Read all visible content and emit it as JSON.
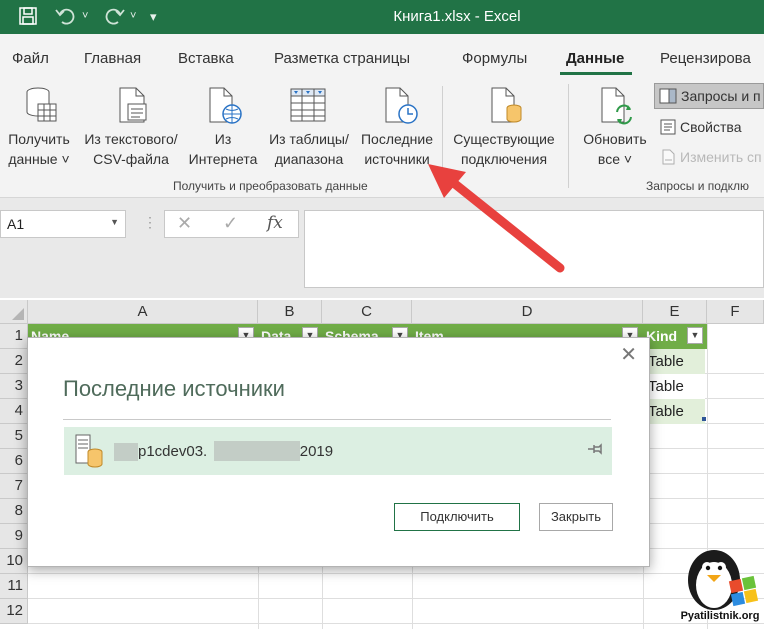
{
  "titlebar": {
    "title": "Книга1.xlsx  -  Excel",
    "bg_color": "#217346"
  },
  "tabs": [
    "Файл",
    "Главная",
    "Вставка",
    "Разметка страницы",
    "Формулы",
    "Данные",
    "Рецензирова"
  ],
  "active_tab": "Данные",
  "ribbon": {
    "get_data": {
      "line1": "Получить",
      "line2": "данные ˅"
    },
    "from_text": {
      "line1": "Из текстового/",
      "line2": "CSV-файла"
    },
    "from_web": {
      "line1": "Из",
      "line2": "Интернета"
    },
    "from_table": {
      "line1": "Из таблицы/",
      "line2": "диапазона"
    },
    "recent_sources": {
      "line1": "Последние",
      "line2": "источники"
    },
    "existing_connections": {
      "line1": "Существующие",
      "line2": "подключения"
    },
    "group1_label": "Получить и преобразовать данные",
    "refresh_all": {
      "line1": "Обновить",
      "line2": "все ˅"
    },
    "queries": "Запросы и п",
    "properties": "Свойства",
    "edit_links": "Изменить сп",
    "group2_label": "Запросы и подклю"
  },
  "formula_bar": {
    "name_box": "A1",
    "fx": "fx"
  },
  "grid": {
    "columns": [
      "A",
      "B",
      "C",
      "D",
      "E",
      "F"
    ],
    "rows": [
      "1",
      "2",
      "3",
      "4",
      "5",
      "6",
      "7",
      "8",
      "9",
      "10",
      "11",
      "12"
    ],
    "headers": [
      "Name",
      "Data",
      "Schema",
      "Item",
      "Kind"
    ],
    "kind_values": [
      "Table",
      "Table",
      "Table"
    ]
  },
  "dialog": {
    "title": "Последние источники",
    "source_text": "p1cdev03.              \\SQL2019",
    "connect_label": "Подключить",
    "close_label": "Закрыть"
  },
  "watermark": "Pyatilistnik.org",
  "colors": {
    "accent": "#217346",
    "table_header": "#70ad47",
    "arrow": "#e8413e",
    "selected_row": "#dcefe2"
  }
}
